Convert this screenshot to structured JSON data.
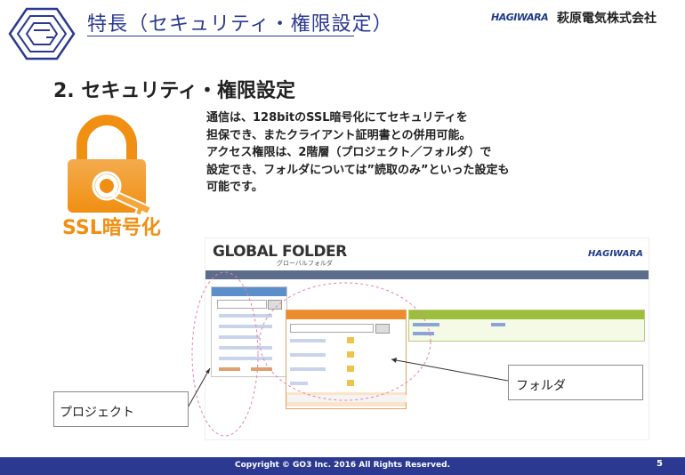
{
  "header": {
    "title": "特長（セキュリティ・権限設定）",
    "company_brand": "HAGIWARA",
    "company_name": "萩原電気株式会社"
  },
  "section": {
    "title": "2. セキュリティ・権限設定"
  },
  "ssl_label": "SSL暗号化",
  "description_lines": [
    "通信は、128bitのSSL暗号化にてセキュリティを",
    "担保でき、またクライアント証明書との併用可能。",
    "アクセス権限は、2階層（プロジェクト／フォルダ）で",
    "設定でき、フォルダについては”読取のみ”といった設定も",
    "可能です。"
  ],
  "screenshot": {
    "logo": "GLOBAL FOLDER",
    "logo_sub": "グローバルフォルダ",
    "brand": "HAGIWARA"
  },
  "callouts": {
    "project": "プロジェクト",
    "folder": "フォルダ"
  },
  "footer": {
    "copyright": "Copyright © GO3 Inc. 2016 All Rights Reserved.",
    "page_number": "5"
  },
  "colors": {
    "brand_navy": "#2b3990",
    "lock_orange": "#f08f12"
  },
  "icons": [
    "go3-logo-icon",
    "padlock-icon",
    "key-icon"
  ]
}
